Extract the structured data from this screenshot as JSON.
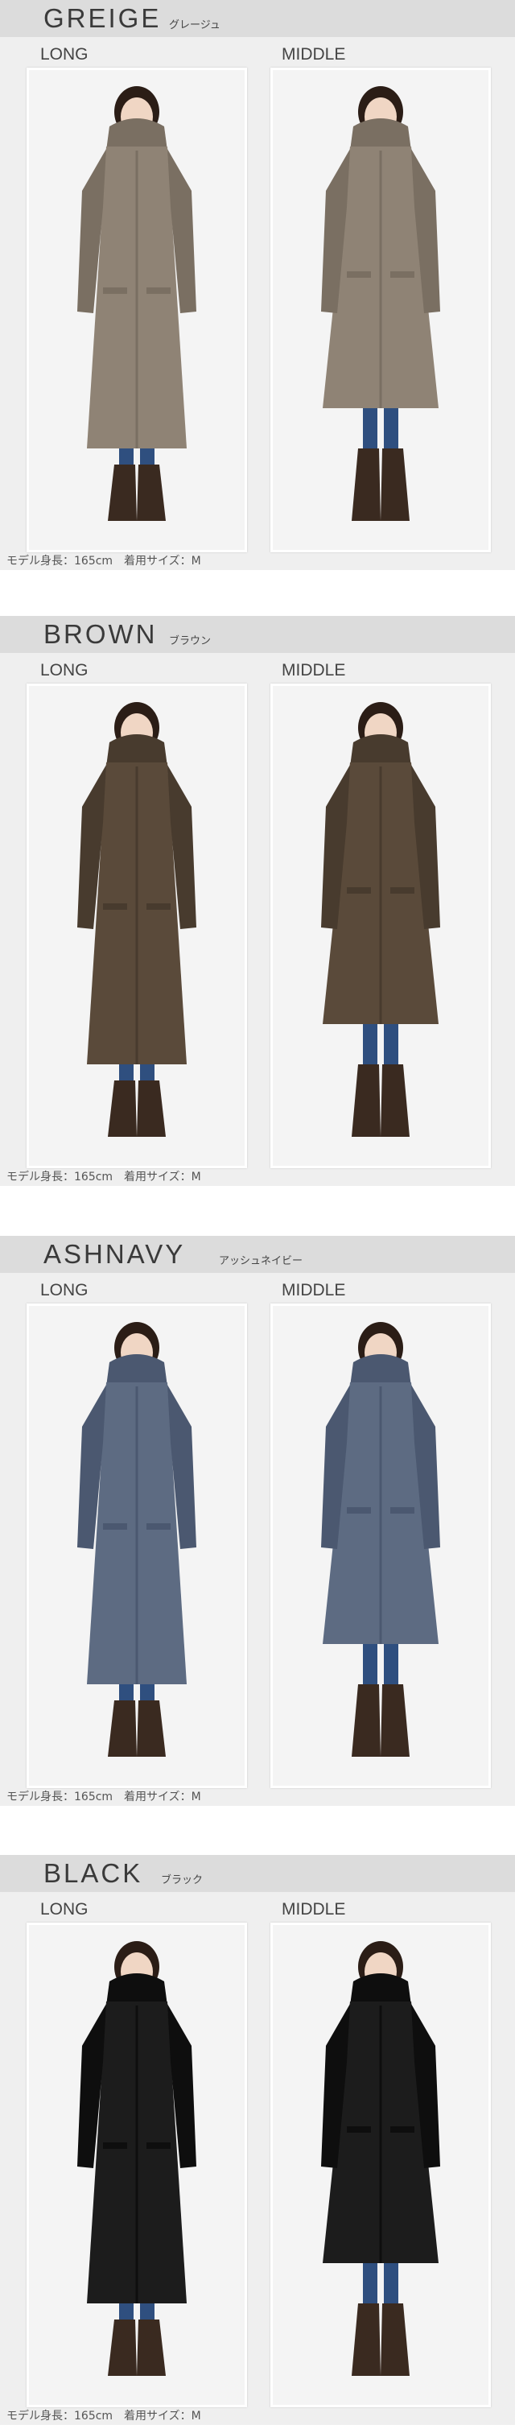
{
  "variants": [
    {
      "name": "GREIGE",
      "kana": "グレージュ",
      "coat_color": "#8f8375",
      "coat_shadow": "#7a6f62",
      "long_label": "LONG",
      "middle_label": "MIDDLE",
      "caption": "モデル身長：165cm　着用サイズ：M"
    },
    {
      "name": "BROWN",
      "kana": "ブラウン",
      "coat_color": "#5a4a3a",
      "coat_shadow": "#483b2e",
      "long_label": "LONG",
      "middle_label": "MIDDLE",
      "caption": "モデル身長：165cm　着用サイズ：M"
    },
    {
      "name": "ASHNAVY",
      "kana": "アッシュネイビー",
      "coat_color": "#5d6b82",
      "coat_shadow": "#4b5870",
      "long_label": "LONG",
      "middle_label": "MIDDLE",
      "caption": "モデル身長：165cm　着用サイズ：M"
    },
    {
      "name": "BLACK",
      "kana": "ブラック",
      "coat_color": "#1c1c1c",
      "coat_shadow": "#0e0e0e",
      "long_label": "LONG",
      "middle_label": "MIDDLE",
      "caption": "モデル身長：165cm　着用サイズ：M"
    }
  ]
}
